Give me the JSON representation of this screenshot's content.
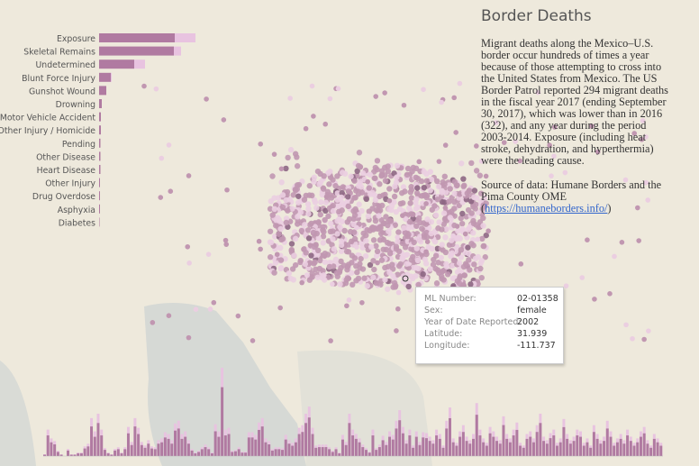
{
  "title": "Border Deaths",
  "description": "Migrant deaths along the Mexico–U.S. border occur hundreds of times a year because of those attempting to cross into the United States from Mexico. The US Border Patrol reported 294 migrant deaths in the fiscal year 2017 (ending September 30, 2017), which was lower than in 2016 (322), and any year during the period 2003-2014. Exposure (including heat stroke, dehydration, and hyperthermia) were the leading cause.",
  "source_prefix": "Source of data: Humane Borders and the Pima County OME (",
  "source_link": "https://humaneborders.info/",
  "source_suffix": ")",
  "colors": {
    "dark": "#b07aa1",
    "light": "#e8c3e0",
    "darkest": "#6b3a64",
    "water": "#c9cfcf",
    "land": "#ece7da"
  },
  "tooltip": {
    "rows": [
      {
        "label": "ML Number:",
        "value": "02-01358"
      },
      {
        "label": "Sex:",
        "value": "female"
      },
      {
        "label": "Year of Date Reported:",
        "value": "2002"
      },
      {
        "label": "Latitude:",
        "value": "31.939"
      },
      {
        "label": "Longitude:",
        "value": "-111.737"
      }
    ]
  },
  "chart_data": [
    {
      "type": "bar",
      "orientation": "horizontal",
      "stacked": true,
      "categories": [
        "Exposure",
        "Skeletal Remains",
        "Undetermined",
        "Blunt Force Injury",
        "Gunshot Wound",
        "Drowning",
        "Motor Vehicle Accident",
        "Other Injury / Homicide",
        "Pending",
        "Other Disease",
        "Heart Disease",
        "Other Injury",
        "Drug Overdose",
        "Asphyxia",
        "Diabetes"
      ],
      "series": [
        {
          "values": [
            84,
            83,
            39,
            13,
            8,
            3,
            2,
            2,
            1.5,
            1.5,
            1.5,
            1,
            1,
            1,
            0.5
          ]
        },
        {
          "values": [
            23,
            8,
            12,
            1,
            0,
            0,
            0,
            0,
            0,
            0,
            0,
            0,
            0,
            0,
            0
          ]
        }
      ]
    },
    {
      "type": "bar",
      "values": [
        2,
        30,
        20,
        17,
        6,
        2,
        0,
        8,
        2,
        2,
        4,
        4,
        11,
        14,
        43,
        28,
        48,
        30,
        9,
        4,
        2,
        8,
        10,
        4,
        10,
        33,
        16,
        43,
        32,
        16,
        12,
        18,
        11,
        10,
        18,
        20,
        27,
        25,
        18,
        37,
        40,
        25,
        28,
        18,
        8,
        4,
        6,
        10,
        13,
        10,
        4,
        36,
        28,
        100,
        30,
        32,
        6,
        7,
        10,
        5,
        5,
        27,
        27,
        24,
        38,
        43,
        20,
        17,
        8,
        10,
        10,
        9,
        24,
        18,
        15,
        20,
        32,
        35,
        48,
        56,
        32,
        12,
        13,
        13,
        13,
        10,
        6,
        10,
        4,
        24,
        16,
        48,
        30,
        25,
        20,
        13,
        9,
        5,
        30,
        9,
        13,
        23,
        16,
        28,
        24,
        40,
        52,
        33,
        18,
        30,
        12,
        28,
        16,
        27,
        26,
        22,
        18,
        30,
        25,
        12,
        40,
        55,
        20,
        15,
        28,
        35,
        22,
        18,
        25,
        60,
        30,
        20,
        15,
        33,
        28,
        22,
        18,
        45,
        25,
        20,
        30,
        38,
        15,
        12,
        25,
        28,
        20,
        35,
        48,
        22,
        18,
        26,
        30,
        15,
        20,
        42,
        25,
        18,
        22,
        30,
        28,
        15,
        20,
        12,
        35,
        25,
        18,
        22,
        40,
        28,
        15,
        20,
        25,
        18,
        30,
        22,
        15,
        20,
        28,
        33,
        18,
        12,
        25,
        20,
        15
      ]
    }
  ]
}
